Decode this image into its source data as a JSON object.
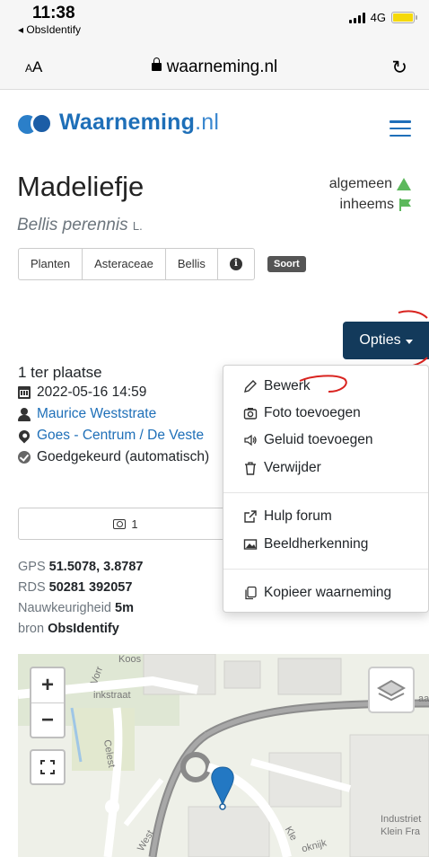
{
  "status_bar": {
    "time": "11:38",
    "back_app": "◂ ObsIdentify",
    "network": "4G"
  },
  "browser": {
    "text_size": "AA",
    "url": "waarneming.nl"
  },
  "site": {
    "logo_main": "Waarneming",
    "logo_tld": ".nl"
  },
  "species": {
    "common_name": "Madeliefje",
    "scientific_name": "Bellis perennis",
    "author": "L.",
    "status_common": "algemeen",
    "status_native": "inheems"
  },
  "breadcrumbs": [
    "Planten",
    "Asteraceae",
    "Bellis"
  ],
  "rank_badge": "Soort",
  "options": {
    "button_label": "Opties",
    "menu": {
      "edit": "Bewerk",
      "add_photo": "Foto toevoegen",
      "add_sound": "Geluid toevoegen",
      "delete": "Verwijder",
      "help_forum": "Hulp forum",
      "image_recognition": "Beeldherkenning",
      "copy": "Kopieer waarneming"
    }
  },
  "observation": {
    "count": "1 ter plaatse",
    "datetime": "2022-05-16 14:59",
    "observer": "Maurice Weststrate",
    "location": "Goes - Centrum / De Veste",
    "status": "Goedgekeurd (automatisch)",
    "photo_count": "1"
  },
  "meta": {
    "gps_label": "GPS",
    "gps_value": "51.5078, 3.8787",
    "rds_label": "RDS",
    "rds_value": "50281 392057",
    "accuracy_label": "Nauwkeurigheid",
    "accuracy_value": "5m",
    "source_label": "bron",
    "source_value": "ObsIdentify"
  },
  "map": {
    "zoom_in": "+",
    "zoom_out": "−",
    "labels": {
      "koos": "Koos",
      "vorr": "Vorr",
      "inkstraat": "inkstraat",
      "celest": "Celest",
      "west": "West",
      "kl": "Kle",
      "oknijk": "oknijk",
      "industrie1": "Industriet",
      "industrie2": "Klein Fra",
      "aa": "aa"
    }
  },
  "colors": {
    "brand_blue": "#1e6fb8",
    "options_bg": "#133a5b",
    "green_status": "#5cb85c",
    "marker_blue": "#2378c3"
  }
}
